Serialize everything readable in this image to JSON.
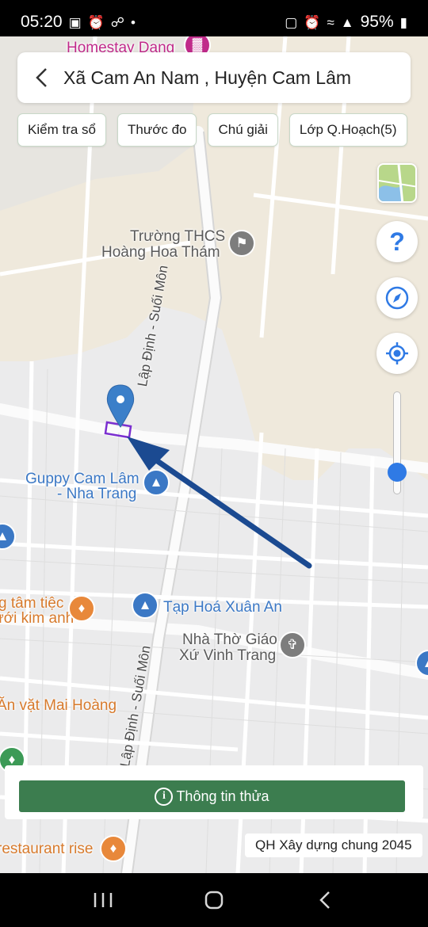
{
  "status_bar": {
    "time": "05:20",
    "battery": "95%",
    "left_icons": [
      "image-icon",
      "alarm-icon",
      "messenger-icon",
      "dot-icon"
    ],
    "right_icons": [
      "nfc-icon",
      "alarm-icon",
      "wifi-icon",
      "signal-icon",
      "battery-icon"
    ]
  },
  "search": {
    "title": "Xã Cam An Nam , Huyện Cam Lâm"
  },
  "chips": [
    {
      "label": "Kiểm tra sổ"
    },
    {
      "label": "Thước đo"
    },
    {
      "label": "Chú giải"
    },
    {
      "label": "Lớp Q.Hoạch(5)"
    }
  ],
  "map": {
    "pois": {
      "homestay": "Homestay Dang",
      "school_line1": "Trường THCS",
      "school_line2": "Hoàng Hoa Thám",
      "guppy_line1": "Guppy Cam Lâm",
      "guppy_line2": "- Nha Trang",
      "taphoa": "Tạp Hoá Xuân An",
      "church_line1": "Nhà Thờ Giáo",
      "church_line2": "Xứ Vinh Trang",
      "tamtiec_line1": "g tâm tiệc",
      "tamtiec_line2": "ưới kim anh",
      "anvat": "Ăn vặt Mai Hoàng",
      "restaurant": "restaurant rise"
    },
    "roads": {
      "upper": "Lập Định - Suối Môn",
      "lower": "Lập Định - Suối Môn"
    }
  },
  "controls": {
    "help_glyph": "?",
    "zoom_level": 0.1
  },
  "info_button": {
    "icon_glyph": "i",
    "label": "Thông tin thửa"
  },
  "plan_label": "QH Xây dựng chung 2045",
  "colors": {
    "accent_green": "#3c7d4f",
    "marker_blue": "#3b7fc9",
    "arrow_navy": "#1b4a91",
    "parcel_purple": "#7b2fd0",
    "slider_blue": "#2f7ae5"
  }
}
